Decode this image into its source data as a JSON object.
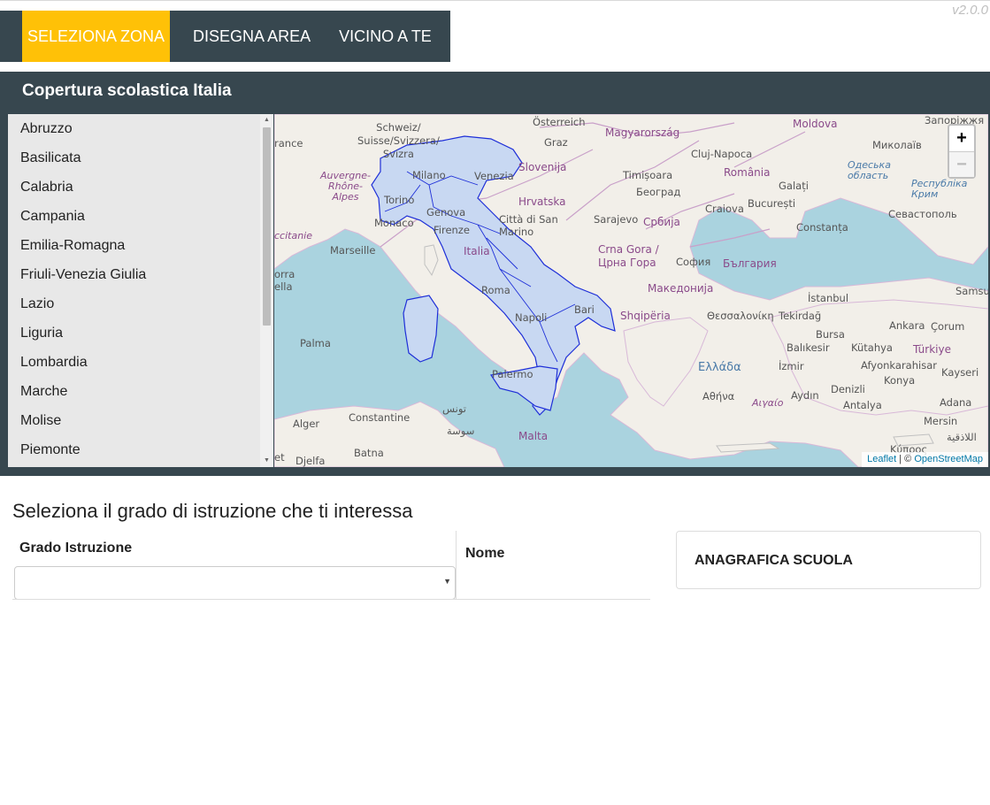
{
  "app": {
    "version": "v2.0.0"
  },
  "nav": {
    "items": [
      {
        "label": "SELEZIONA ZONA",
        "active": true
      },
      {
        "label": "DISEGNA AREA",
        "active": false
      },
      {
        "label": "VICINO A TE",
        "active": false
      }
    ]
  },
  "panel": {
    "title": "Copertura scolastica Italia"
  },
  "regions": [
    "Abruzzo",
    "Basilicata",
    "Calabria",
    "Campania",
    "Emilia-Romagna",
    "Friuli-Venezia Giulia",
    "Lazio",
    "Liguria",
    "Lombardia",
    "Marche",
    "Molise",
    "Piemonte"
  ],
  "map": {
    "zoom_in": "+",
    "zoom_out": "−",
    "attribution_leaflet": "Leaflet",
    "attribution_sep": " | © ",
    "attribution_osm": "OpenStreetMap",
    "labels": {
      "osterreich": "Österreich",
      "schweiz": "Schweiz/\nSuisse/Svizzera/\nSvizra",
      "magyarorszag": "Magyarország",
      "moldova": "Moldova",
      "zaporizhzhia": "Запоріжжя",
      "mykolaiv": "Миколаїв",
      "cluj": "Cluj-Napoca",
      "romania": "România",
      "odeska": "Одеська\nобласть",
      "krym": "Республіка\nКрим",
      "graz": "Graz",
      "slovenija": "Slovenija",
      "timisoara": "Timișoara",
      "galati": "Galați",
      "milano": "Milano",
      "venezia": "Venezia",
      "hrvatska": "Hrvatska",
      "beograd": "Београд",
      "craiova": "Craiova",
      "bucuresti": "București",
      "sevastopol": "Севастополь",
      "auvergne": "Auvergne-\nRhône-\nAlpes",
      "torino": "Torino",
      "genova": "Genova",
      "citta_sm": "Città di San\nMarino",
      "sarajevo": "Sarajevo",
      "srbija": "Србија",
      "constanta": "Constanța",
      "monaco": "Monaco",
      "firenze": "Firenze",
      "occitanie": "ccitanie",
      "marseille": "Marseille",
      "italia": "Italia",
      "crna_gora": "Crna Gora /\nЦрна Гора",
      "sofia": "София",
      "bulgaria": "България",
      "roma": "Roma",
      "makedonija": "Македонија",
      "istanbul": "İstanbul",
      "samsun": "Samsu",
      "bari": "Bari",
      "napoli": "Napoli",
      "shqiperia": "Shqipëria",
      "thessaloniki": "Θεσσαλονίκη",
      "tekirdag": "Tekirdağ",
      "ankara": "Ankara",
      "corum": "Çorum",
      "palma": "Palma",
      "bursa": "Bursa",
      "balikesir": "Balıkesir",
      "kutahya": "Kütahya",
      "turkiye": "Türkiye",
      "ellada": "Ελλάδα",
      "izmir": "İzmir",
      "afyon": "Afyonkarahisar",
      "kayseri": "Kayseri",
      "palermo": "Palermo",
      "konya": "Konya",
      "athina": "Αθήνα",
      "aigaio": "Αιγαίο",
      "aydin": "Aydın",
      "denizli": "Denizli",
      "tunis": "تونس",
      "constantine": "Constantine",
      "antalya": "Antalya",
      "adana": "Adana",
      "alger": "Alger",
      "sousse": "سوسة",
      "malta": "Malta",
      "mersin": "Mersin",
      "latakia": "اللاذقية",
      "djelfa": "Djelfa",
      "batna": "Batna",
      "kypros": "Κύπρος",
      "france_edge": "rance",
      "corsica_edge": "orra\nella",
      "et_edge": "et"
    }
  },
  "filters": {
    "section_title": "Seleziona il grado di istruzione che ti interessa",
    "grade_label": "Grado Istruzione",
    "grade_value": "",
    "name_label": "Nome"
  },
  "school": {
    "title": "ANAGRAFICA SCUOLA"
  },
  "colors": {
    "navbar": "#37474f",
    "active_tab": "#ffc107",
    "sea": "#aad3df",
    "land": "#f2efe9",
    "italy_fill": "#c8d8f2",
    "italy_stroke": "#1e2fd8"
  }
}
